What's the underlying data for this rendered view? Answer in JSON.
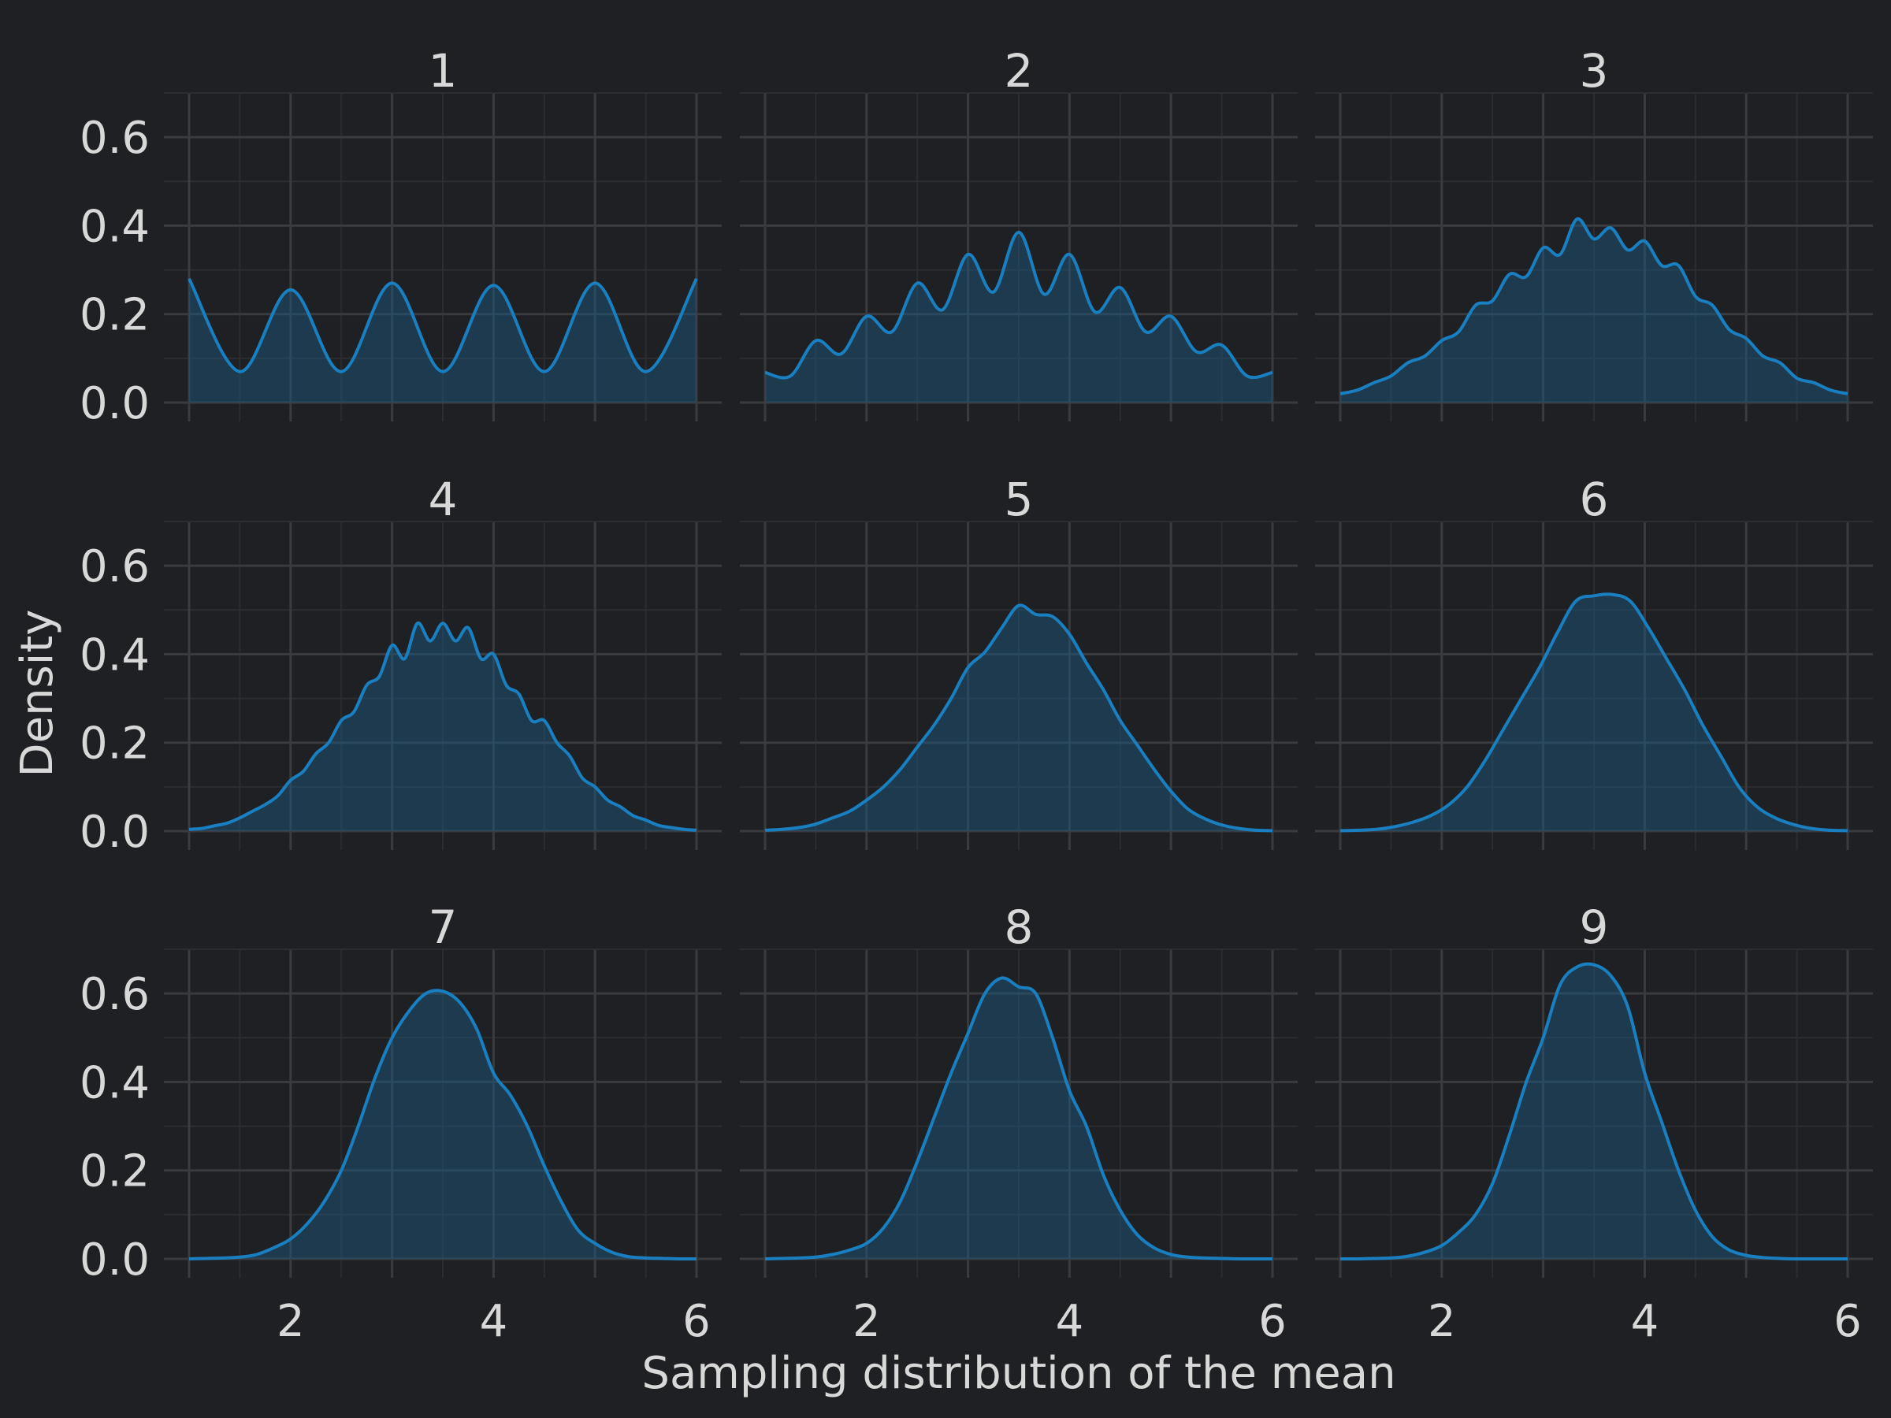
{
  "chart_data": {
    "type": "area",
    "layout": "facet-grid 3x3",
    "xlabel": "Sampling distribution of the mean",
    "ylabel": "Density",
    "xlim": [
      1,
      6
    ],
    "ylim": [
      0,
      0.7
    ],
    "x_ticks": [
      2,
      4,
      6
    ],
    "x_tick_labels": [
      "2",
      "4",
      "6"
    ],
    "y_ticks": [
      0,
      0.2,
      0.4,
      0.6
    ],
    "y_tick_labels": [
      "0.0",
      "0.2",
      "0.4",
      "0.6"
    ],
    "grid": true,
    "colors": {
      "background": "#1f2023",
      "line": "#1a7fc1",
      "fill": "#1a5a85",
      "grid_major": "#3a3b3e",
      "grid_minor": "#2c2d30",
      "text": "#d8d8d8"
    },
    "panels": [
      {
        "title": "1",
        "kind": "ripple",
        "x": [
          1,
          6
        ],
        "values": [
          0.28,
          0.07,
          0.255,
          0.07,
          0.27,
          0.07,
          0.265,
          0.07,
          0.27,
          0.07,
          0.28
        ]
      },
      {
        "title": "2",
        "kind": "ripple",
        "x": [
          1,
          6
        ],
        "values": [
          0.068,
          0.06,
          0.14,
          0.11,
          0.195,
          0.16,
          0.27,
          0.21,
          0.335,
          0.25,
          0.385,
          0.245,
          0.335,
          0.205,
          0.26,
          0.16,
          0.195,
          0.115,
          0.13,
          0.06,
          0.068
        ]
      },
      {
        "title": "3",
        "kind": "smooth",
        "x": [
          1,
          6
        ],
        "values": [
          0.02,
          0.028,
          0.045,
          0.06,
          0.09,
          0.105,
          0.14,
          0.16,
          0.22,
          0.23,
          0.29,
          0.285,
          0.35,
          0.335,
          0.415,
          0.37,
          0.395,
          0.345,
          0.365,
          0.31,
          0.31,
          0.24,
          0.22,
          0.165,
          0.145,
          0.105,
          0.09,
          0.055,
          0.045,
          0.028,
          0.02
        ]
      },
      {
        "title": "4",
        "kind": "smooth",
        "x": [
          1,
          6
        ],
        "values": [
          0.004,
          0.006,
          0.012,
          0.018,
          0.03,
          0.045,
          0.06,
          0.08,
          0.115,
          0.135,
          0.175,
          0.2,
          0.25,
          0.27,
          0.33,
          0.35,
          0.42,
          0.39,
          0.47,
          0.43,
          0.47,
          0.43,
          0.46,
          0.39,
          0.4,
          0.33,
          0.31,
          0.25,
          0.25,
          0.2,
          0.17,
          0.12,
          0.1,
          0.07,
          0.055,
          0.035,
          0.025,
          0.013,
          0.008,
          0.004,
          0.002
        ]
      },
      {
        "title": "5",
        "kind": "smooth",
        "x": [
          1,
          6
        ],
        "values": [
          0.002,
          0.004,
          0.008,
          0.016,
          0.03,
          0.045,
          0.07,
          0.1,
          0.14,
          0.19,
          0.24,
          0.3,
          0.37,
          0.405,
          0.46,
          0.51,
          0.49,
          0.485,
          0.445,
          0.38,
          0.32,
          0.25,
          0.195,
          0.14,
          0.09,
          0.05,
          0.028,
          0.014,
          0.006,
          0.002,
          0.001
        ]
      },
      {
        "title": "6",
        "kind": "smooth",
        "x": [
          1,
          6
        ],
        "values": [
          0.001,
          0.002,
          0.004,
          0.01,
          0.02,
          0.035,
          0.06,
          0.1,
          0.16,
          0.23,
          0.3,
          0.37,
          0.45,
          0.52,
          0.532,
          0.535,
          0.52,
          0.46,
          0.39,
          0.32,
          0.24,
          0.17,
          0.1,
          0.055,
          0.03,
          0.015,
          0.006,
          0.002,
          0.001
        ]
      },
      {
        "title": "7",
        "kind": "smooth",
        "x": [
          1,
          6
        ],
        "values": [
          0.0,
          0.001,
          0.002,
          0.004,
          0.01,
          0.025,
          0.045,
          0.08,
          0.13,
          0.2,
          0.3,
          0.41,
          0.5,
          0.56,
          0.6,
          0.605,
          0.58,
          0.52,
          0.42,
          0.37,
          0.3,
          0.21,
          0.13,
          0.065,
          0.035,
          0.015,
          0.005,
          0.002,
          0.001,
          0.0,
          0.0
        ]
      },
      {
        "title": "8",
        "kind": "smooth",
        "x": [
          1,
          6
        ],
        "values": [
          0.0,
          0.001,
          0.002,
          0.004,
          0.01,
          0.02,
          0.035,
          0.07,
          0.13,
          0.22,
          0.32,
          0.42,
          0.51,
          0.6,
          0.635,
          0.615,
          0.6,
          0.5,
          0.38,
          0.3,
          0.19,
          0.11,
          0.055,
          0.025,
          0.01,
          0.004,
          0.002,
          0.001,
          0.0,
          0.0,
          0.0
        ]
      },
      {
        "title": "9",
        "kind": "smooth",
        "x": [
          1,
          6
        ],
        "values": [
          0.0,
          0.0,
          0.001,
          0.002,
          0.006,
          0.015,
          0.03,
          0.06,
          0.1,
          0.17,
          0.28,
          0.4,
          0.5,
          0.62,
          0.66,
          0.665,
          0.64,
          0.57,
          0.42,
          0.31,
          0.2,
          0.11,
          0.05,
          0.02,
          0.008,
          0.003,
          0.001,
          0.0,
          0.0,
          0.0,
          0.0
        ]
      }
    ]
  }
}
